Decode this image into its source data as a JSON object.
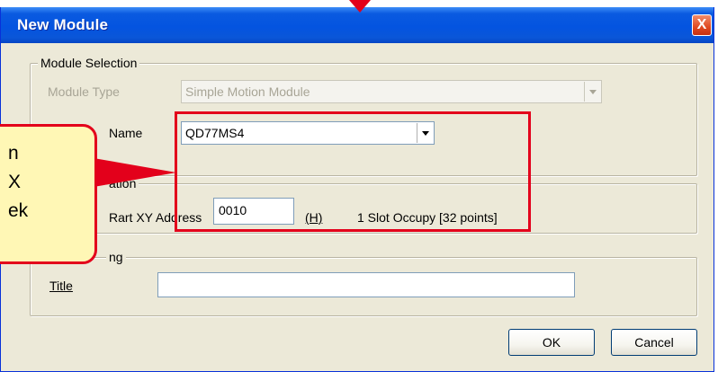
{
  "window": {
    "title": "New Module",
    "close_label": "X"
  },
  "module_selection": {
    "legend": "Module Selection",
    "module_type_label": "Module Type",
    "module_type_value": "Simple Motion Module",
    "module_name_label": "Name",
    "module_name_value": "QD77MS4"
  },
  "mount_position": {
    "legend_fragment": "ation",
    "start_xy_label": "Rart XY Address",
    "start_xy_value": "0010",
    "hex_suffix": "(H)",
    "slot_info": "1 Slot Occupy [32 points]"
  },
  "title_setting": {
    "legend_fragment": "ng",
    "title_label": "Title",
    "title_value": ""
  },
  "buttons": {
    "ok": "OK",
    "cancel": "Cancel"
  },
  "annotation": {
    "callout_lines": [
      "n",
      "X",
      "ek"
    ],
    "highlight_color": "#e3001b",
    "callout_fill": "#fff7b5"
  },
  "colors": {
    "titlebar": "#0454e0",
    "window_face": "#ece9d8",
    "field_border": "#7f9db9",
    "disabled_text": "#a8a596"
  }
}
